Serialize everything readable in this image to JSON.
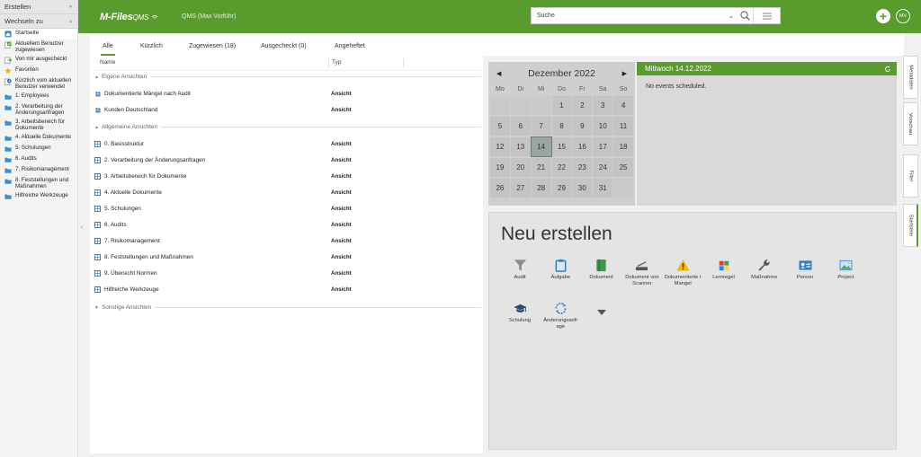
{
  "app": {
    "logo": "M-Files",
    "logo_sub": "QMS",
    "vault": "QMS (Max Vorführ)",
    "search_placeholder": "Suche",
    "user_initials": "MV"
  },
  "colors": {
    "accent": "#5a9b2d"
  },
  "sidebar": {
    "create_label": "Erstellen",
    "switch_label": "Wechseln zu",
    "items": [
      {
        "label": "Startseite",
        "icon": "home-icon",
        "color": "#2f7ec7"
      },
      {
        "label": "Aktuellem Benutzer zugewiesen",
        "icon": "assigned-icon",
        "color": "#4a9a3a"
      },
      {
        "label": "Von mir ausgecheckt",
        "icon": "checked-out-icon",
        "color": "#4a9a3a"
      },
      {
        "label": "Favoriten",
        "icon": "star-icon",
        "color": "#e7b416"
      },
      {
        "label": "Kürzlich vom aktuellen Benutzer verwendet",
        "icon": "recent-icon",
        "color": "#2f7ec7"
      },
      {
        "label": "1. Employees",
        "icon": "folder-icon",
        "color": "#3a8fd0"
      },
      {
        "label": "2. Verarbeitung der Änderungsanfragen",
        "icon": "folder-icon",
        "color": "#3a8fd0"
      },
      {
        "label": "3. Arbeitsbereich für Dokumente",
        "icon": "folder-icon",
        "color": "#3a8fd0"
      },
      {
        "label": "4. Aktuelle Dokumente",
        "icon": "folder-icon",
        "color": "#3a8fd0"
      },
      {
        "label": "5. Schulungen",
        "icon": "folder-icon",
        "color": "#3a8fd0"
      },
      {
        "label": "6. Audits",
        "icon": "folder-icon",
        "color": "#3a8fd0"
      },
      {
        "label": "7. Risikomanagement",
        "icon": "folder-icon",
        "color": "#3a8fd0"
      },
      {
        "label": "8. Feststellungen und Maßnahmen",
        "icon": "folder-icon",
        "color": "#3a8fd0"
      },
      {
        "label": "Hilfreiche Werkzeuge",
        "icon": "folder-icon",
        "color": "#3a8fd0"
      }
    ]
  },
  "tabs": [
    "Alle",
    "Kürzlich",
    "Zugewiesen (18)",
    "Ausgecheckt (0)",
    "Angeheftet"
  ],
  "list": {
    "col_name": "Name",
    "col_type": "Typ",
    "group_own": "Eigene Ansichten",
    "own_rows": [
      {
        "name": "Dokumentierte Mängel nach Audit",
        "type": "Ansicht"
      },
      {
        "name": "Kunden Deutschland",
        "type": "Ansicht"
      }
    ],
    "group_general": "Allgemeine Ansichten",
    "general_rows": [
      {
        "name": "0. Basisstruktur",
        "type": "Ansicht"
      },
      {
        "name": "2. Verarbeitung der Änderungsanfragen",
        "type": "Ansicht"
      },
      {
        "name": "3. Arbeitsbereich für Dokumente",
        "type": "Ansicht"
      },
      {
        "name": "4. Aktuelle Dokumente",
        "type": "Ansicht"
      },
      {
        "name": "5. Schulungen",
        "type": "Ansicht"
      },
      {
        "name": "6. Audits",
        "type": "Ansicht"
      },
      {
        "name": "7. Risikomanagement",
        "type": "Ansicht"
      },
      {
        "name": "8. Feststellungen und Maßnahmen",
        "type": "Ansicht"
      },
      {
        "name": "9. Übersicht Normen",
        "type": "Ansicht"
      },
      {
        "name": "Hilfreiche Werkzeuge",
        "type": "Ansicht"
      }
    ],
    "group_other": "Sonstige Ansichten"
  },
  "calendar": {
    "month_title": "Dezember 2022",
    "weekdays": [
      "Mo",
      "Di",
      "Mi",
      "Do",
      "Fr",
      "Sa",
      "So"
    ],
    "leading_blanks": 3,
    "days_in_month": 31,
    "today": 14,
    "events_title": "Mittwoch 14.12.2022",
    "events_empty": "No events scheduled."
  },
  "create": {
    "title": "Neu erstellen",
    "items": [
      {
        "label": "Audit",
        "icon": "filter-icon"
      },
      {
        "label": "Aufgabe",
        "icon": "clipboard-icon"
      },
      {
        "label": "Dokument",
        "icon": "document-icon"
      },
      {
        "label": "Dokument von Scanner",
        "icon": "scanner-icon"
      },
      {
        "label": "Dokumentierte r Mangel",
        "icon": "warning-icon"
      },
      {
        "label": "Lernregel",
        "icon": "grid-icon"
      },
      {
        "label": "Maßnahme",
        "icon": "wrench-icon"
      },
      {
        "label": "Person",
        "icon": "id-card-icon"
      },
      {
        "label": "Project",
        "icon": "image-icon"
      },
      {
        "label": "Schulung",
        "icon": "graduation-cap-icon"
      },
      {
        "label": "Änderungsanfr age",
        "icon": "refresh-circle-icon"
      }
    ]
  },
  "right_tabs": [
    "Metadaten",
    "Vorschau",
    "Filter",
    "Startseite"
  ]
}
